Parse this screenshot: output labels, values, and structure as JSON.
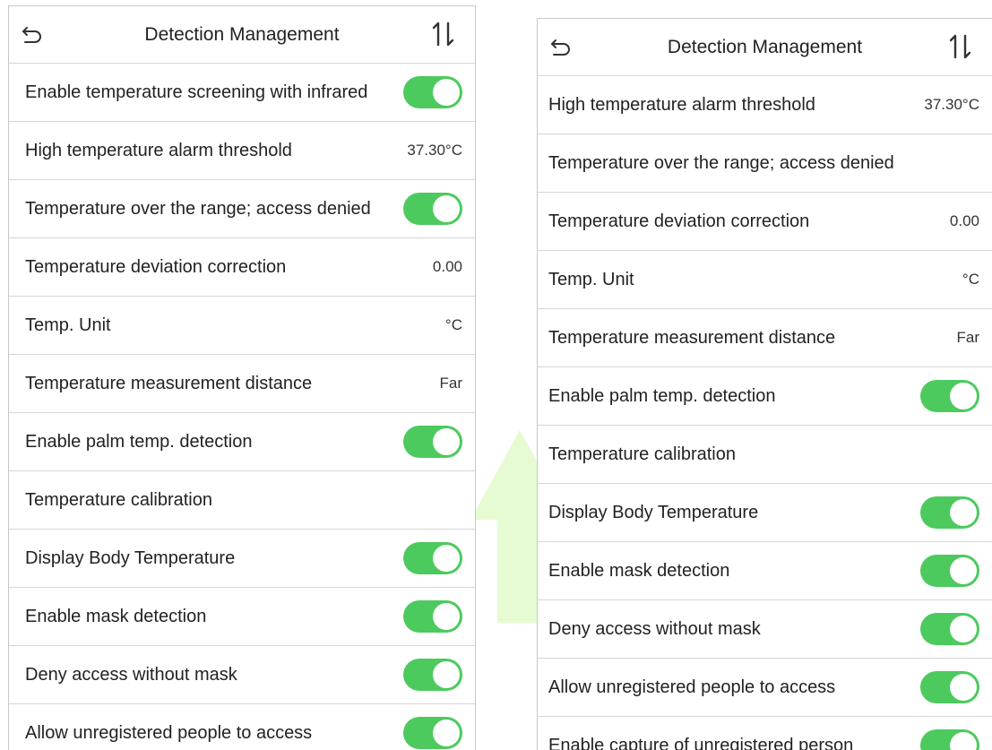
{
  "colors": {
    "toggle_on": "#4cca5e",
    "border": "#d6d6d6",
    "watermark": "#e6fbd2"
  },
  "left": {
    "header": {
      "title": "Detection Management",
      "back_icon": "back-arrow-icon",
      "sort_icon": "sort-icon"
    },
    "rows": [
      {
        "label": "Enable temperature screening with infrared",
        "toggle": true
      },
      {
        "label": "High temperature alarm threshold",
        "value": "37.30°C"
      },
      {
        "label": "Temperature over the range; access denied",
        "toggle": true
      },
      {
        "label": "Temperature deviation correction",
        "value": "0.00"
      },
      {
        "label": "Temp. Unit",
        "value": "°C"
      },
      {
        "label": "Temperature measurement distance",
        "value": "Far"
      },
      {
        "label": "Enable palm temp. detection",
        "toggle": true
      },
      {
        "label": "Temperature calibration"
      },
      {
        "label": "Display Body Temperature",
        "toggle": true
      },
      {
        "label": "Enable mask detection",
        "toggle": true
      },
      {
        "label": "Deny access without mask",
        "toggle": true
      },
      {
        "label": "Allow unregistered people to access",
        "toggle": true
      }
    ]
  },
  "right": {
    "header": {
      "title": "Detection Management",
      "back_icon": "back-arrow-icon",
      "sort_icon": "sort-icon"
    },
    "rows": [
      {
        "label": "High temperature alarm threshold",
        "value": "37.30°C"
      },
      {
        "label": "Temperature over the range; access denied"
      },
      {
        "label": "Temperature deviation correction",
        "value": "0.00"
      },
      {
        "label": "Temp. Unit",
        "value": "°C"
      },
      {
        "label": "Temperature measurement distance",
        "value": "Far"
      },
      {
        "label": "Enable palm temp. detection",
        "toggle": true
      },
      {
        "label": "Temperature calibration"
      },
      {
        "label": "Display Body Temperature",
        "toggle": true
      },
      {
        "label": "Enable mask detection",
        "toggle": true
      },
      {
        "label": "Deny access without mask",
        "toggle": true
      },
      {
        "label": "Allow unregistered people to access",
        "toggle": true
      },
      {
        "label": "Enable capture of unregistered person",
        "toggle": true
      }
    ]
  }
}
